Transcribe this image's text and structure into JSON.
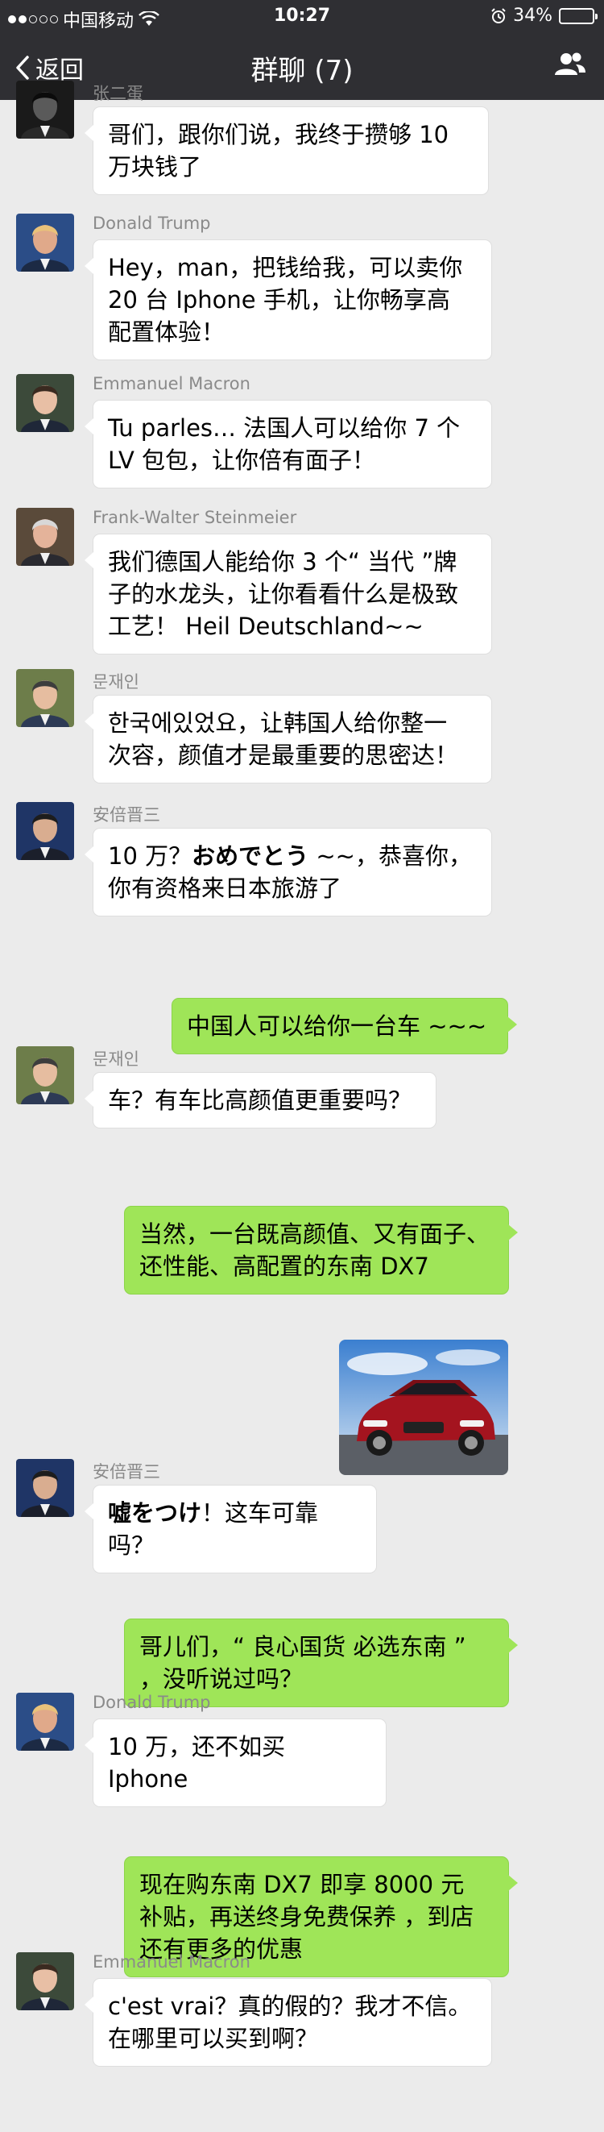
{
  "status": {
    "carrier": "中国移动",
    "time": "10:27",
    "battery_text": "34%",
    "battery_level": 0.34
  },
  "nav": {
    "back_label": "返回",
    "title": "群聊 (7)"
  },
  "messages": [
    {
      "sender": "张二蛋",
      "avatar": "avatar-zhang",
      "lines": [
        "哥们，跟你们说，我终于攒够 10",
        "万块钱了"
      ]
    },
    {
      "sender": "Donald Trump",
      "avatar": "avatar-trump",
      "lines": [
        "Hey，man，把钱给我，可以卖你",
        "20 台 Iphone 手机，让你畅享高",
        "配置体验！"
      ]
    },
    {
      "sender": "Emmanuel Macron",
      "avatar": "avatar-macron",
      "lines": [
        "Tu parles… 法国人可以给你 7 个",
        "LV 包包，让你倍有面子！"
      ]
    },
    {
      "sender": "Frank-Walter Steinmeier",
      "avatar": "avatar-steinmeier",
      "lines": [
        "我们德国人能给你 3 个“ 当代 ”牌",
        "子的水龙头，让你看看什么是极致",
        "工艺！ Heil Deutschland~~"
      ]
    },
    {
      "sender": "문재인",
      "avatar": "avatar-moon",
      "lines": [
        "한국에있었요，让韩国人给你整一",
        "次容，颜值才是最重要的思密达！"
      ]
    },
    {
      "sender": "安倍晋三",
      "avatar": "avatar-abe",
      "lines_rich": [
        [
          "10 万？",
          "おめでとう",
          " ~~，恭喜你，"
        ],
        [
          "你有资格来日本旅游了"
        ]
      ]
    },
    {
      "sender": "",
      "self": true,
      "lines": [
        "中国人可以给你一台车 ~~~"
      ]
    },
    {
      "sender": "문재인",
      "avatar": "avatar-moon",
      "lines": [
        "车？有车比高颜值更重要吗？"
      ]
    },
    {
      "sender": "",
      "self": true,
      "lines": [
        "当然，一台既高颜值、又有面子、",
        "还性能、高配置的东南 DX7"
      ]
    },
    {
      "sender": "",
      "self": true,
      "image": "red-suv-photo"
    },
    {
      "sender": "安倍晋三",
      "avatar": "avatar-abe",
      "lines_rich": [
        [
          "",
          "嘘をつけ",
          "！这车可靠吗？"
        ]
      ]
    },
    {
      "sender": "",
      "self": true,
      "lines": [
        "哥儿们，“ 良心国货 必选东南 ”",
        "，没听说过吗？"
      ]
    },
    {
      "sender": "Donald Trump",
      "avatar": "avatar-trump",
      "lines": [
        "10 万，还不如买 Iphone"
      ]
    },
    {
      "sender": "",
      "self": true,
      "lines": [
        "现在购东南 DX7 即享 8000 元",
        "补贴，再送终身免费保养 ，到店",
        "还有更多的优惠"
      ]
    },
    {
      "sender": "Emmanuel Macron",
      "avatar": "avatar-macron",
      "lines": [
        "c'est vrai？真的假的？我才不信。",
        "在哪里可以买到啊？"
      ]
    }
  ],
  "colors": {
    "header_bg": "#2f2f33",
    "page_bg": "#ebebeb",
    "self_bubble": "#9fe558",
    "other_bubble": "#ffffff"
  }
}
